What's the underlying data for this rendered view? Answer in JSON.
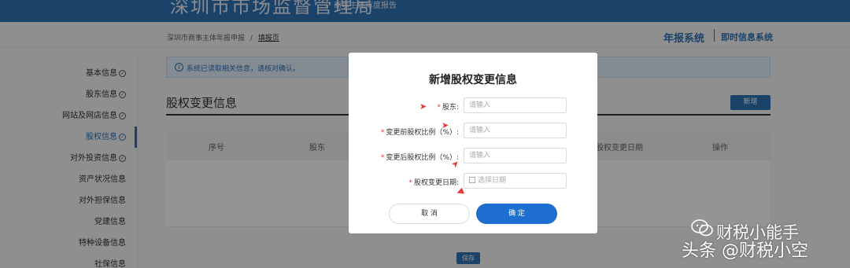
{
  "header": {
    "site_name": "深圳市市场监督管理局",
    "subtitle": "商事主体年度报告"
  },
  "breadcrumb": {
    "root": "深圳市商事主体年报申报",
    "separator": "/",
    "current": "填报页"
  },
  "system_nav": {
    "annual": "年报系统",
    "instant": "即时信息系统"
  },
  "sidebar": {
    "items": [
      {
        "label": "基本信息",
        "checked": true,
        "active": false
      },
      {
        "label": "股东信息",
        "checked": true,
        "active": false
      },
      {
        "label": "网站及网店信息",
        "checked": true,
        "active": false
      },
      {
        "label": "股权信息",
        "checked": true,
        "active": true
      },
      {
        "label": "对外投资信息",
        "checked": true,
        "active": false
      },
      {
        "label": "资产状况信息",
        "checked": false,
        "active": false
      },
      {
        "label": "对外担保信息",
        "checked": false,
        "active": false
      },
      {
        "label": "党建信息",
        "checked": false,
        "active": false
      },
      {
        "label": "特种设备信息",
        "checked": false,
        "active": false
      },
      {
        "label": "社保信息",
        "checked": false,
        "active": false
      }
    ]
  },
  "alert": {
    "icon": "info-icon",
    "text": "系统已读取相关信息，请核对确认。"
  },
  "section": {
    "title": "股权变更信息",
    "add_button": "新增"
  },
  "table": {
    "columns": [
      "序号",
      "股东",
      "股权变更日期",
      "操作"
    ]
  },
  "save_button": "保存",
  "modal": {
    "title": "新增股权变更信息",
    "fields": [
      {
        "label": "股东:",
        "required": true,
        "placeholder": "请输入"
      },
      {
        "label": "变更前股权比例（%）:",
        "required": true,
        "placeholder": "请输入"
      },
      {
        "label": "变更后股权比例（%）:",
        "required": true,
        "placeholder": "请输入"
      },
      {
        "label": "股权变更日期:",
        "required": true,
        "placeholder": "选择日期",
        "icon": "calendar-icon"
      }
    ],
    "cancel": "取 消",
    "confirm": "确 定"
  },
  "watermark": {
    "line1": "财税小能手",
    "line2": "头条 @财税小空"
  },
  "colors": {
    "primary": "#2f73b6",
    "confirm": "#1e6fd0",
    "required": "#e53935"
  }
}
